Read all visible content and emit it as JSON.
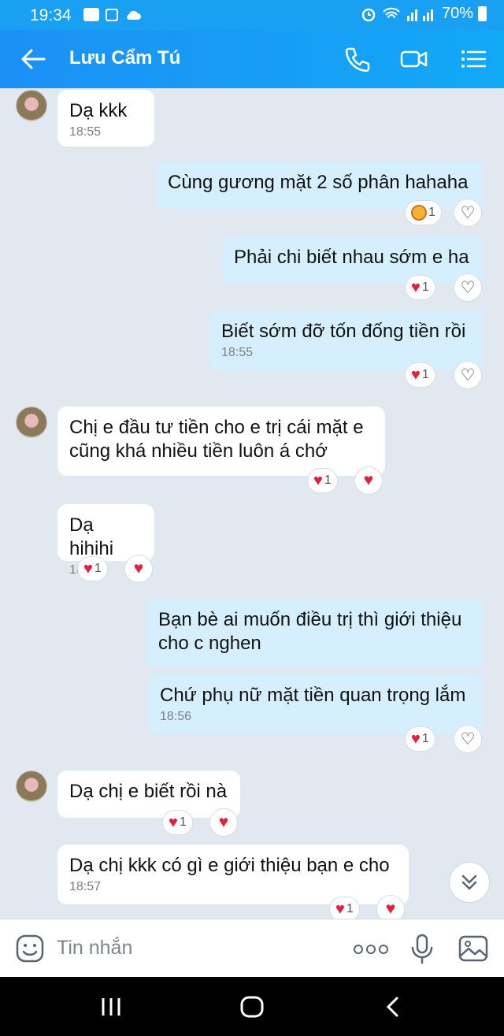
{
  "status": {
    "time": "19:34",
    "battery": "70%"
  },
  "header": {
    "contact_name": "Lưu Cẩm Tú"
  },
  "messages": [
    {
      "dir": "in",
      "text": "Dạ kkk",
      "time": "18:55"
    },
    {
      "dir": "out",
      "text": "Cùng gương mặt 2 số phân hahaha",
      "reaction_count": "1"
    },
    {
      "dir": "out",
      "text": "Phải chi biết nhau sớm e ha",
      "reaction_count": "1"
    },
    {
      "dir": "out",
      "text": "Biết sớm đỡ tốn đống tiền rồi",
      "time": "18:55",
      "reaction_count": "1"
    },
    {
      "dir": "in",
      "text": "Chị e đầu tư tiền cho e trị cái mặt e cũng khá nhiều tiền luôn á chớ",
      "reaction_count": "1"
    },
    {
      "dir": "in",
      "text": "Dạ hihihi",
      "time": "18:55",
      "reaction_count": "1"
    },
    {
      "dir": "out",
      "text": "Bạn bè ai muốn điều trị thì giới thiệu cho c nghen"
    },
    {
      "dir": "out",
      "text": "Chứ phụ nữ mặt tiền quan trọng lắm",
      "time": "18:56",
      "reaction_count": "1"
    },
    {
      "dir": "in",
      "text": "Dạ chị e biết rồi nà",
      "reaction_count": "1"
    },
    {
      "dir": "in",
      "text": "Dạ chị kkk có gì e giới thiệu bạn e cho",
      "time": "18:57",
      "reaction_count": "1"
    }
  ],
  "composer": {
    "placeholder": "Tin nhắn"
  },
  "colors": {
    "header": "#1c90f5",
    "outgoing_bubble": "#d5efff",
    "incoming_bubble": "#ffffff",
    "heart": "#e3203b",
    "chat_bg": "#e2e8ef"
  },
  "icons": [
    "back-arrow-icon",
    "phone-icon",
    "video-call-icon",
    "menu-list-icon",
    "emoji-icon",
    "more-dots-icon",
    "microphone-icon",
    "image-icon",
    "chevrons-down-icon",
    "heart-icon"
  ]
}
